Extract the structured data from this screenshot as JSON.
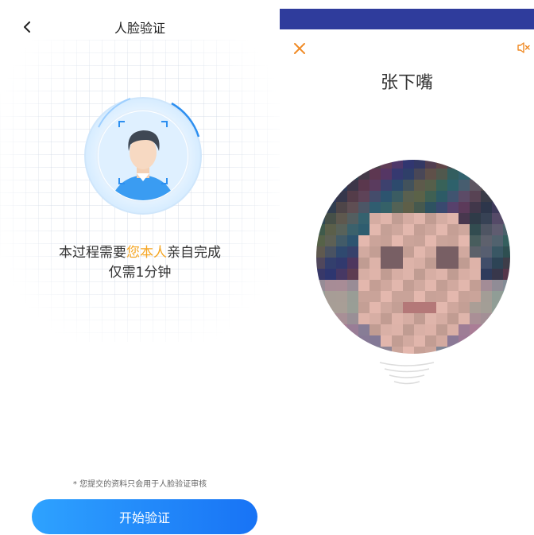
{
  "left": {
    "title": "人脸验证",
    "headline_before": "本过程需要",
    "headline_highlight": "您本人",
    "headline_after": "亲自完成",
    "subline": "仅需1分钟",
    "privacy_note": "* 您提交的资料只会用于人脸验证审核",
    "start_button": "开始验证"
  },
  "right": {
    "person_name": "张下嘴"
  },
  "colors": {
    "accent_orange": "#f5a623",
    "button_blue": "#1e8bfa",
    "status_bar": "#2f3c9c",
    "close_orange": "#f08a24"
  }
}
